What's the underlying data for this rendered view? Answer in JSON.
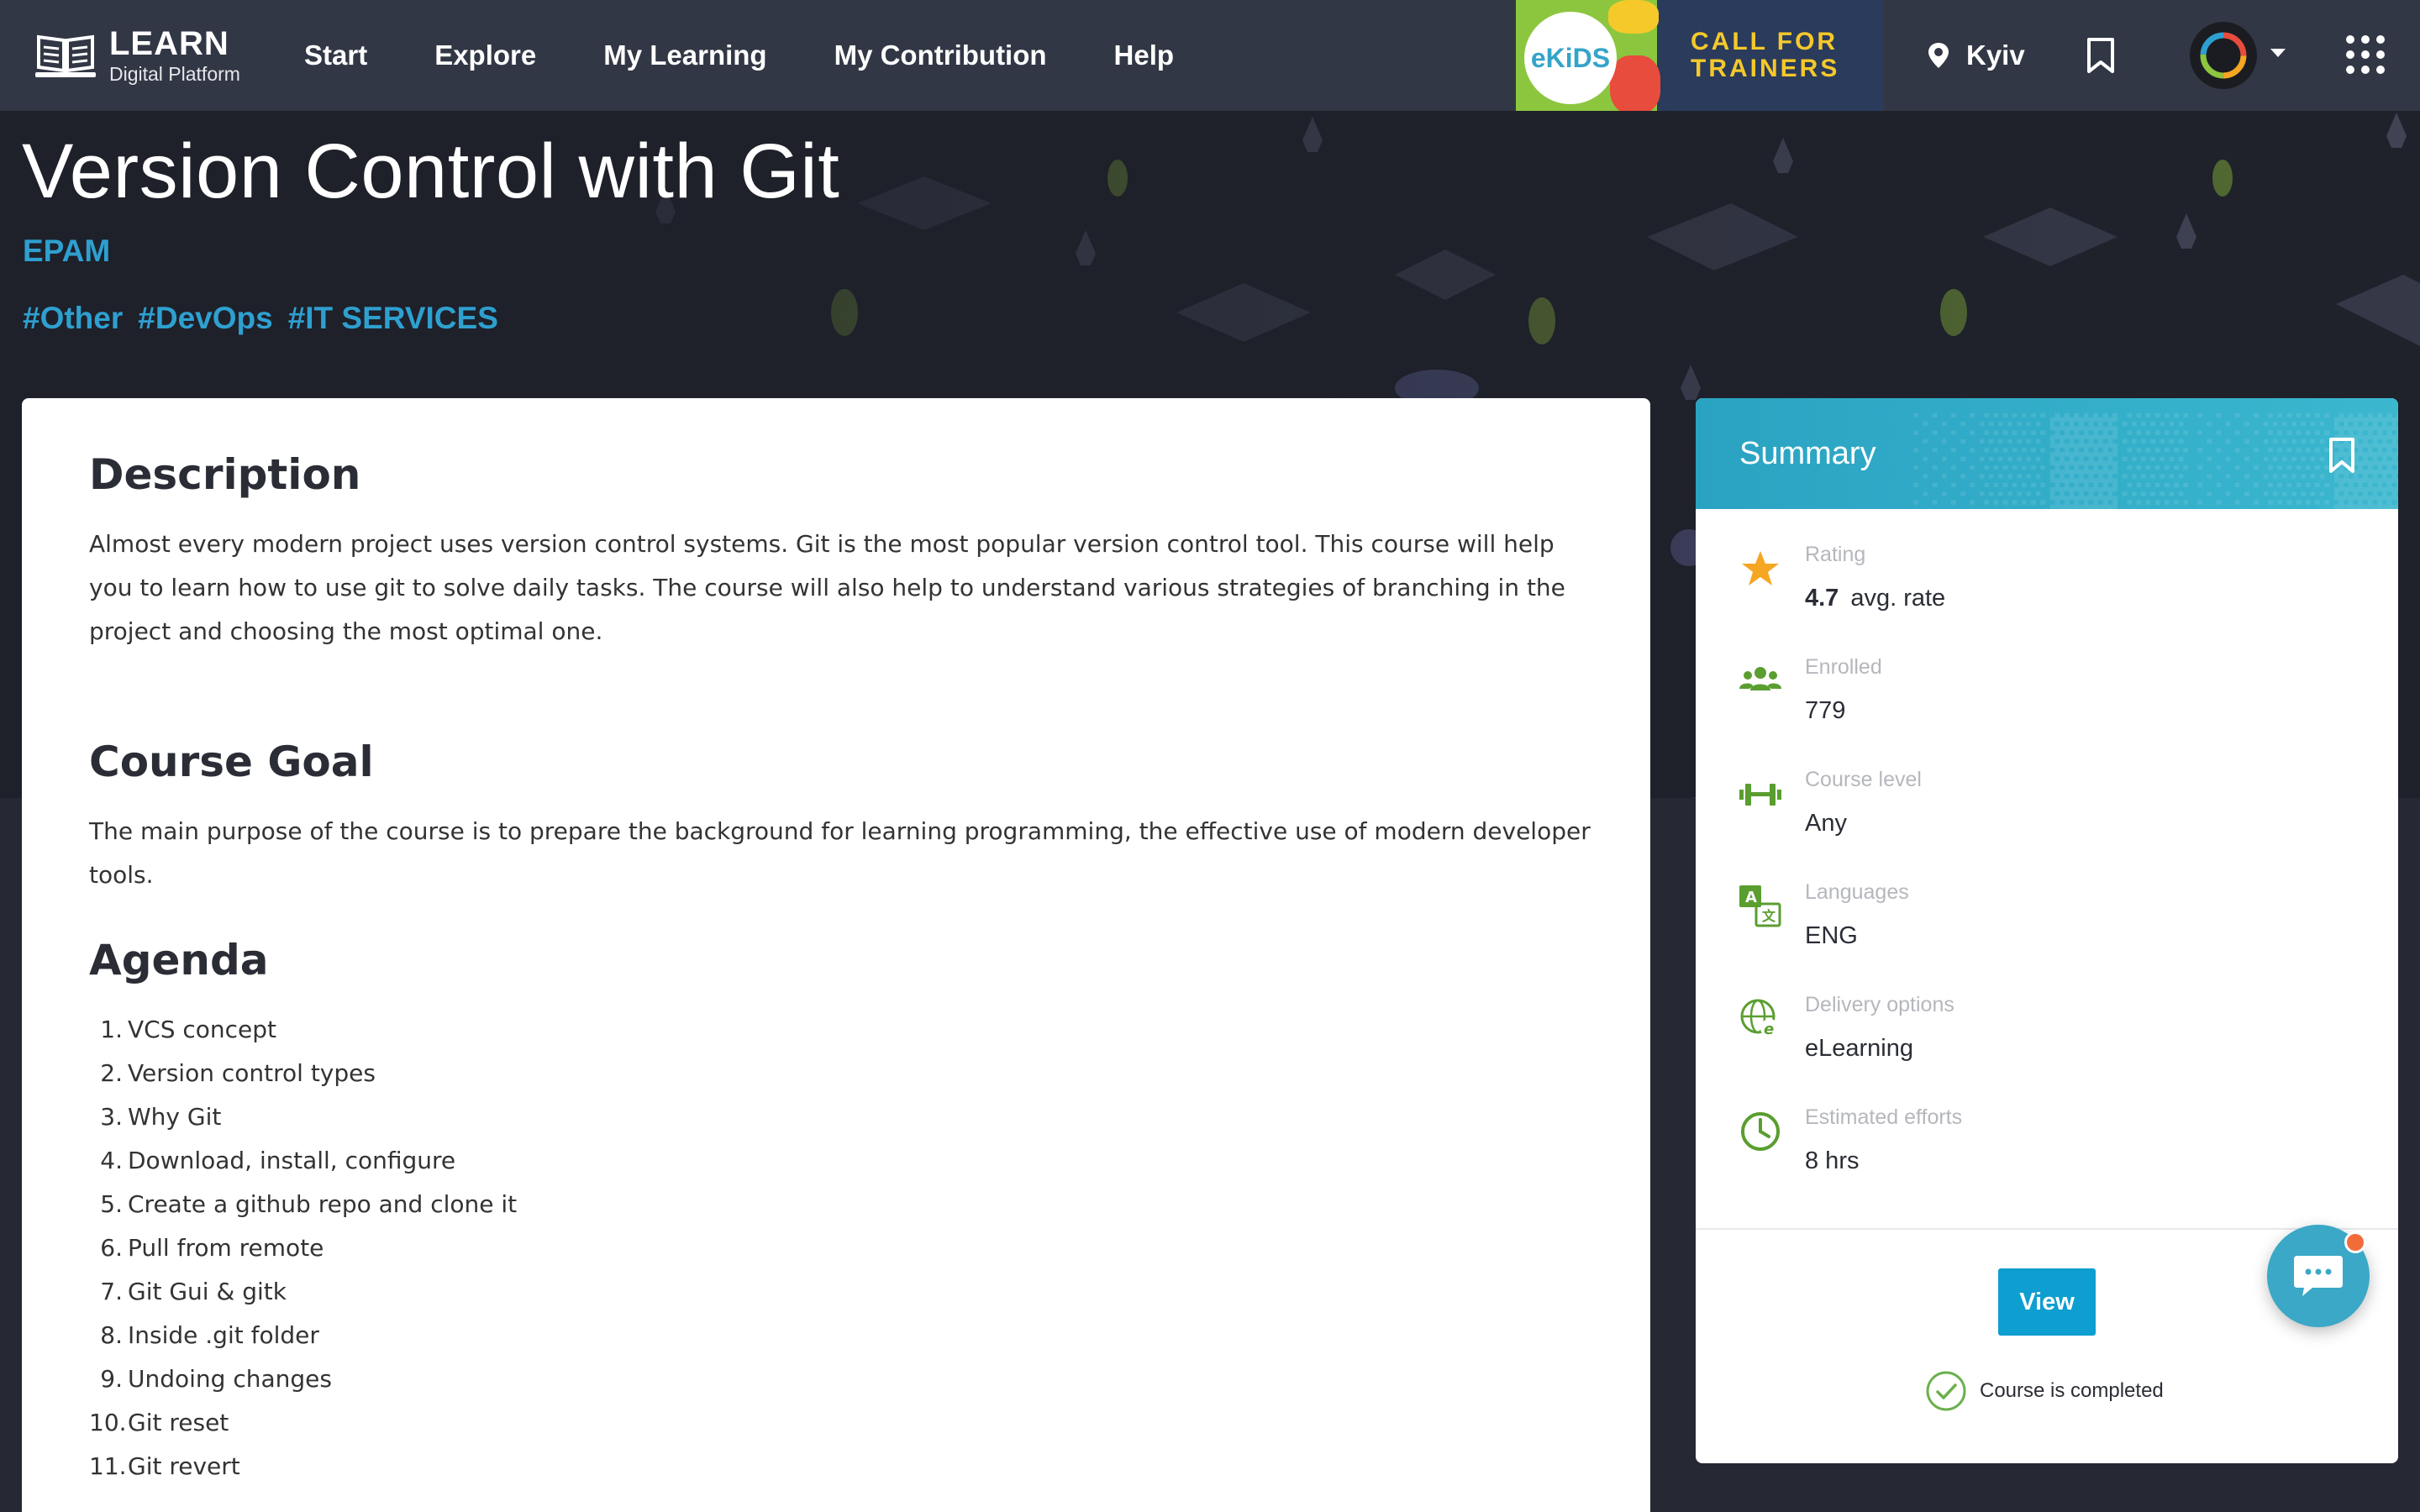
{
  "nav": {
    "logo_title": "LEARN",
    "logo_subtitle": "Digital Platform",
    "items": [
      "Start",
      "Explore",
      "My Learning",
      "My Contribution",
      "Help"
    ],
    "banner": {
      "brand": "eKiDS",
      "line1": "CALL FOR",
      "line2": "TRAINERS"
    },
    "location": "Kyiv",
    "icons": [
      "book-icon",
      "location-pin-icon",
      "bookmark-icon",
      "avatar-ring-icon",
      "chevron-down-icon",
      "apps-grid-icon"
    ]
  },
  "course": {
    "title": "Version Control with Git",
    "provider": "EPAM",
    "tags": [
      "#Other",
      "#DevOps",
      "#IT SERVICES"
    ]
  },
  "description": {
    "heading": "Description",
    "text": "Almost every modern project uses version control systems. Git is the most popular version control tool. This course will help you to learn how to use git to solve daily tasks. The course will also help to understand various strategies of branching  in the project and choosing the most optimal one."
  },
  "goal": {
    "heading": "Course Goal",
    "text": "The main purpose of the course is to prepare the background for learning programming, the effective use of modern developer tools."
  },
  "agenda": {
    "heading": "Agenda",
    "items": [
      {
        "num": "1.",
        "text": "VCS concept"
      },
      {
        "num": "2.",
        "text": "Version control types"
      },
      {
        "num": "3.",
        "text": "Why Git"
      },
      {
        "num": "4.",
        "text": "Download, install, configure"
      },
      {
        "num": "5.",
        "text": "Create a github repo and clone it"
      },
      {
        "num": "6.",
        "text": "Pull from remote"
      },
      {
        "num": "7.",
        "text": "Git Gui & gitk"
      },
      {
        "num": "8.",
        "text": "Inside .git folder"
      },
      {
        "num": "9.",
        "text": "Undoing changes"
      },
      {
        "num": "10.",
        "text": "Git reset"
      },
      {
        "num": "11.",
        "text": "Git revert"
      }
    ]
  },
  "summary": {
    "title": "Summary",
    "rating": {
      "label": "Rating",
      "value": "4.7",
      "suffix": "avg. rate"
    },
    "enrolled": {
      "label": "Enrolled",
      "value": "779"
    },
    "level": {
      "label": "Course level",
      "value": "Any"
    },
    "languages": {
      "label": "Languages",
      "value": "ENG"
    },
    "delivery": {
      "label": "Delivery options",
      "value": "eLearning"
    },
    "efforts": {
      "label": "Estimated efforts",
      "value": "8 hrs"
    },
    "view_button": "View",
    "status": "Course is completed"
  },
  "colors": {
    "nav_bg": "#323745",
    "accent_blue": "#2ea0d0",
    "button_blue": "#0e9ed0",
    "icon_green": "#5a9e2f",
    "star_orange": "#f5a623"
  }
}
